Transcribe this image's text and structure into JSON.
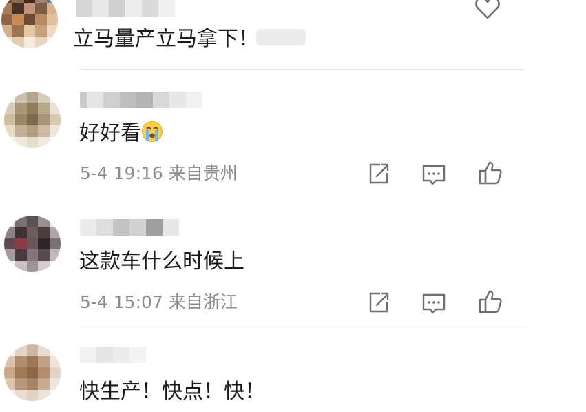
{
  "comments": [
    {
      "text": "立马量产立马拿下！",
      "meta": ""
    },
    {
      "text": "好好看",
      "emoji": "crying-face-emoji",
      "meta": "5-4 19:16 来自贵州"
    },
    {
      "text": "这款车什么时候上",
      "meta": "5-4 15:07 来自浙江"
    },
    {
      "text": "快生产！快点！快！",
      "meta": ""
    }
  ],
  "icons": {
    "share": "share-icon",
    "comment": "comment-icon",
    "like": "like-icon",
    "heart": "heart-icon"
  },
  "colors": {
    "text": "#1a1a1a",
    "meta": "#8c8c8c",
    "icon": "#6f6f6f",
    "divider": "#e8e8e8"
  }
}
